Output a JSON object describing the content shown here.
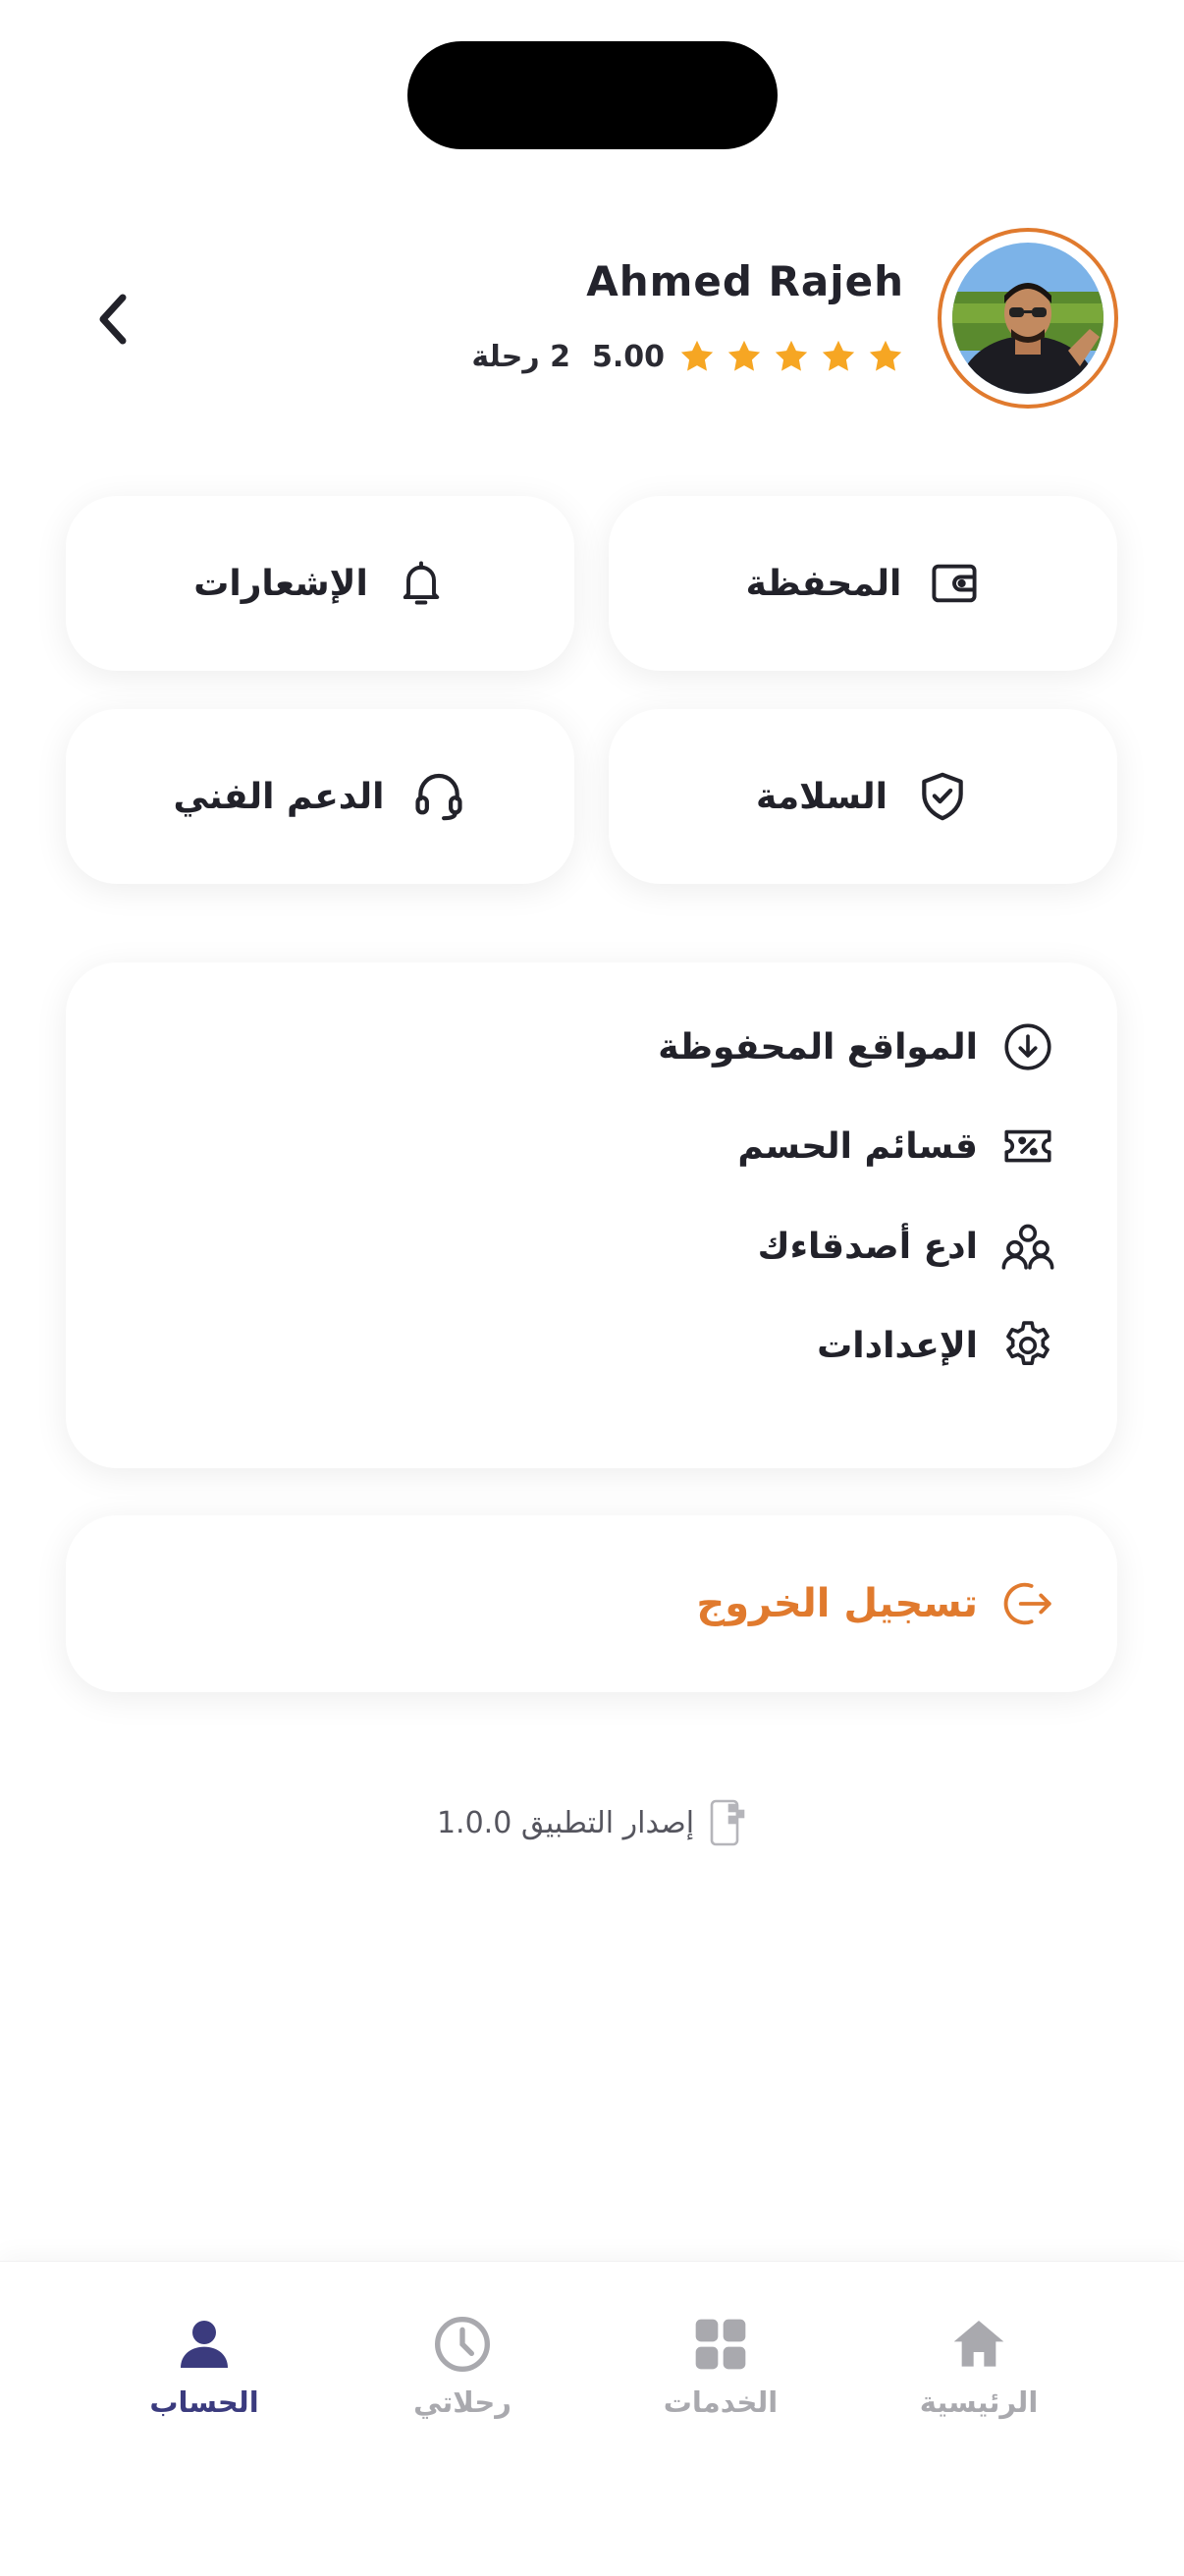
{
  "profile": {
    "name": "Ahmed Rajeh",
    "rating": "5.00",
    "trips": "2 رحلة",
    "stars": 5
  },
  "tiles": {
    "wallet": "المحفظة",
    "notifications": "الإشعارات",
    "safety": "السلامة",
    "support": "الدعم الفني"
  },
  "menu": {
    "saved_locations": "المواقع المحفوظة",
    "coupons": "قسائم الحسم",
    "invite_friends": "ادع أصدقاءك",
    "settings": "الإعدادات"
  },
  "logout": {
    "label": "تسجيل الخروج"
  },
  "version": {
    "text": "إصدار التطبيق 1.0.0"
  },
  "tabbar": {
    "home": "الرئيسية",
    "services": "الخدمات",
    "trips": "رحلاتي",
    "account": "الحساب"
  },
  "colors": {
    "accent": "#e07a2e",
    "star": "#f6a623",
    "active_tab": "#3b3b7e",
    "inactive_tab": "#a9a9ae"
  },
  "icons": [
    "chevron-left-icon",
    "star-icon",
    "wallet-icon",
    "bell-icon",
    "shield-check-icon",
    "headset-icon",
    "download-circle-icon",
    "ticket-percent-icon",
    "users-icon",
    "gear-icon",
    "logout-icon",
    "phone-qr-icon",
    "home-icon",
    "grid-icon",
    "clock-icon",
    "user-icon"
  ]
}
